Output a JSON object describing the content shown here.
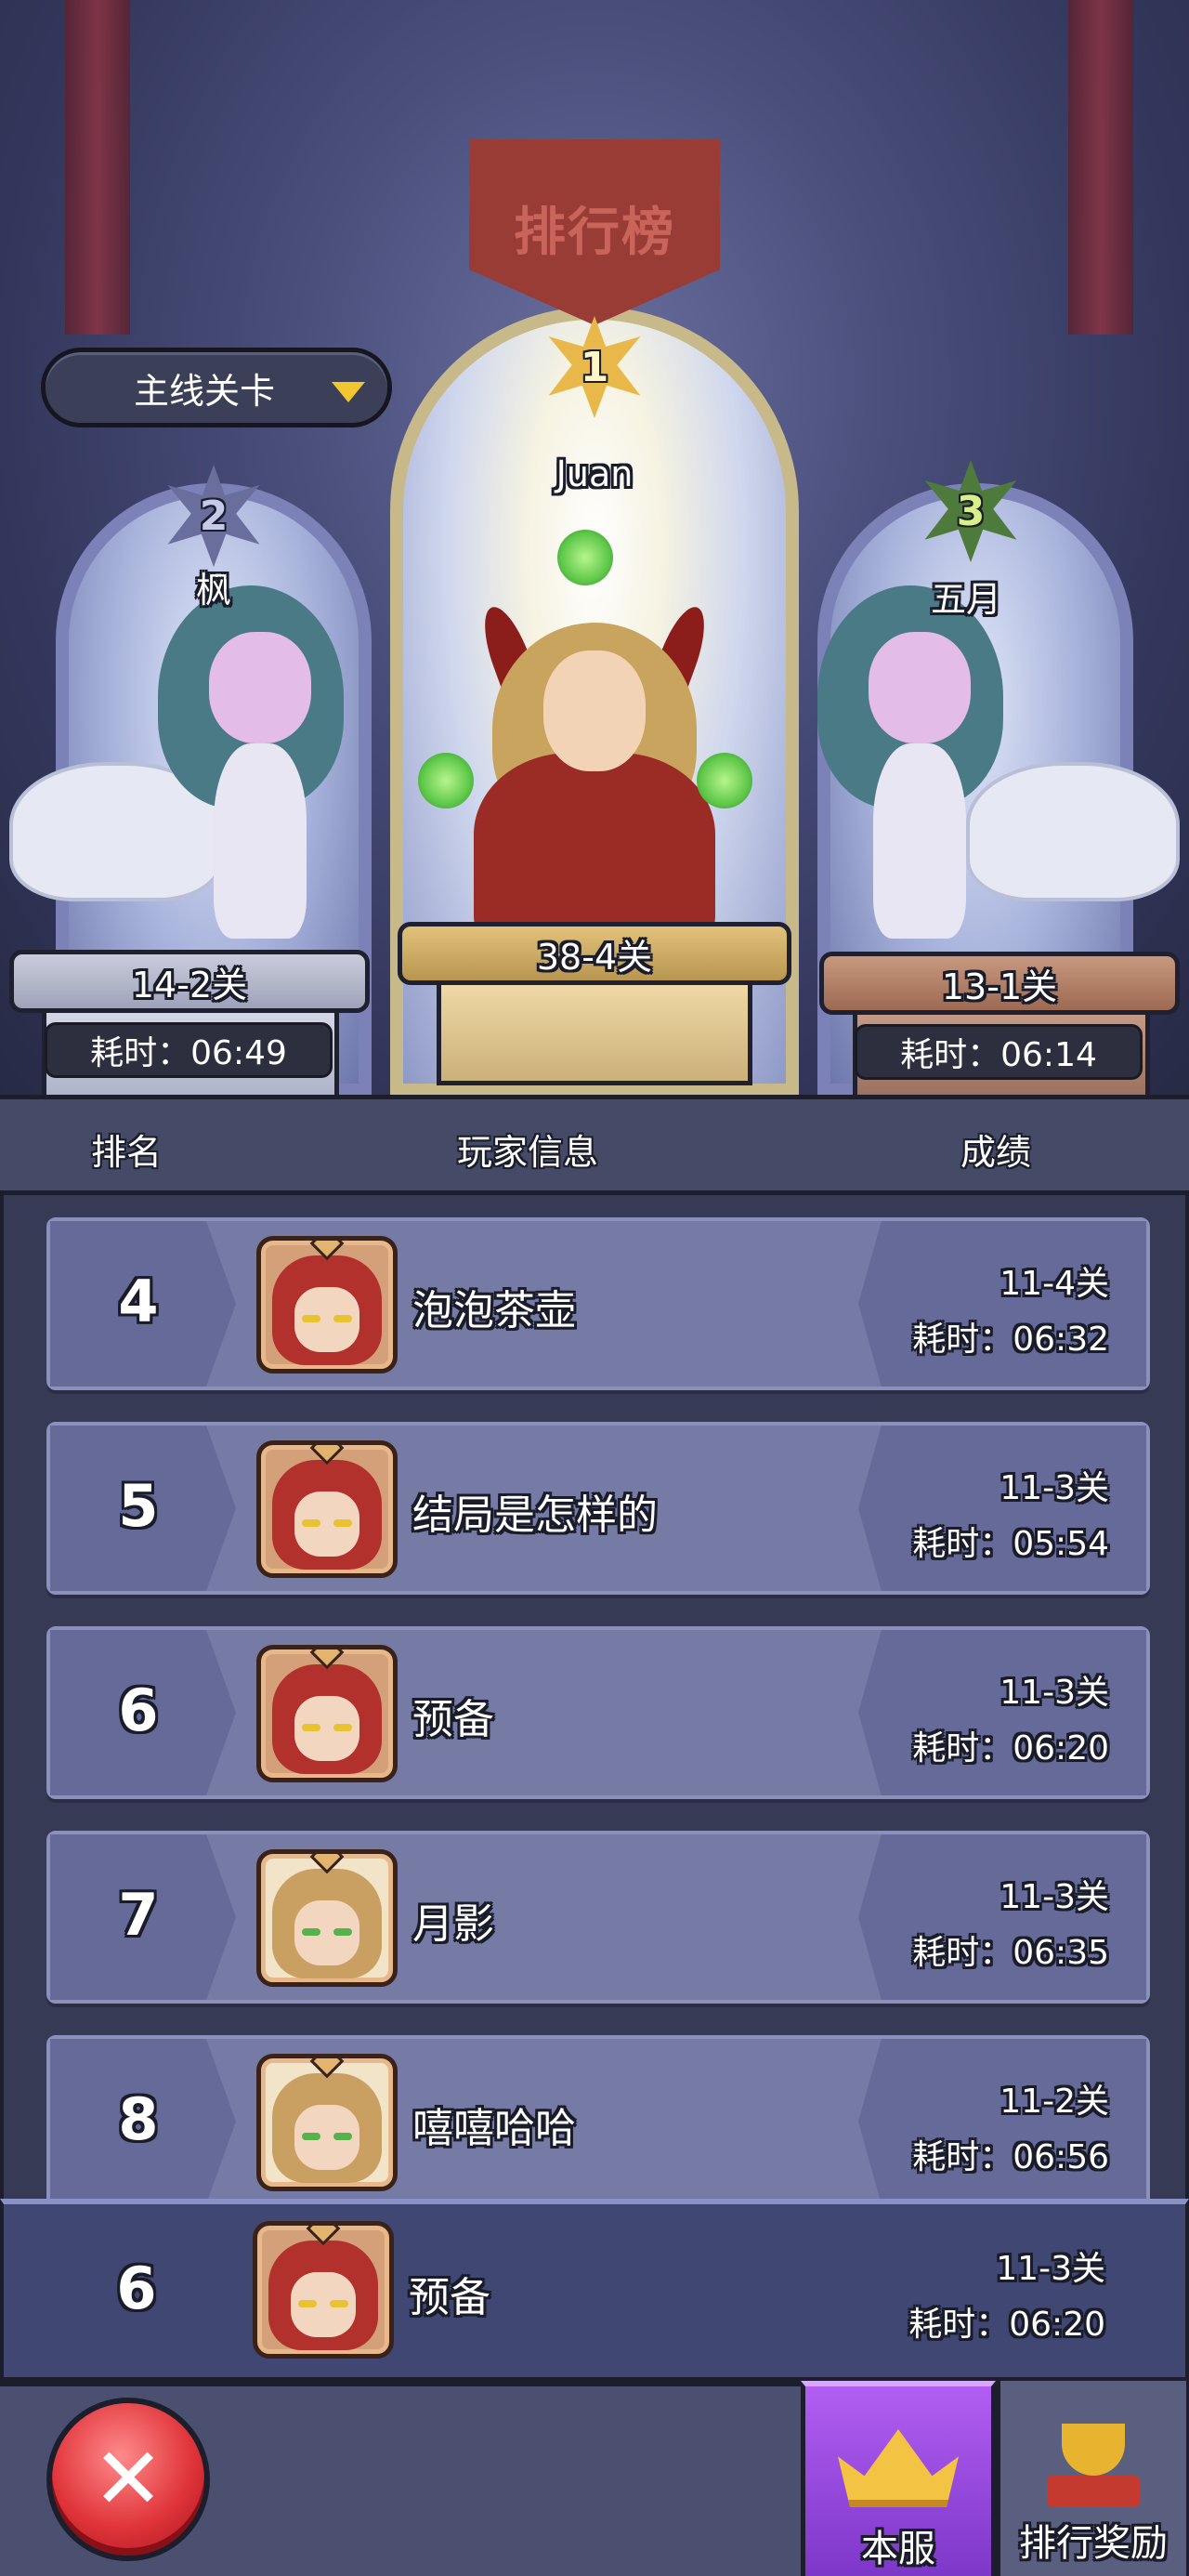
{
  "title": "排行榜",
  "mode_select": {
    "label": "主线关卡"
  },
  "podium": [
    {
      "rank": "1",
      "name": "Juan",
      "stage": "38-4关"
    },
    {
      "rank": "2",
      "name": "枫",
      "stage": "14-2关",
      "time": "耗时：06:49"
    },
    {
      "rank": "3",
      "name": "五月",
      "stage": "13-1关",
      "time": "耗时：06:14"
    }
  ],
  "header": {
    "rank": "排名",
    "player": "玩家信息",
    "score": "成绩"
  },
  "rows": [
    {
      "rank": "4",
      "name": "泡泡茶壶",
      "stage": "11-4关",
      "time": "耗时：06:32",
      "avatar": "red-hair-avatar"
    },
    {
      "rank": "5",
      "name": "结局是怎样的",
      "stage": "11-3关",
      "time": "耗时：05:54",
      "avatar": "red-hair-avatar"
    },
    {
      "rank": "6",
      "name": "预备",
      "stage": "11-3关",
      "time": "耗时：06:20",
      "avatar": "red-hair-avatar"
    },
    {
      "rank": "7",
      "name": "月影",
      "stage": "11-3关",
      "time": "耗时：06:35",
      "avatar": "blond-hair-avatar"
    },
    {
      "rank": "8",
      "name": "嘻嘻哈哈",
      "stage": "11-2关",
      "time": "耗时：06:56",
      "avatar": "blond-hair-avatar"
    }
  ],
  "self_row": {
    "rank": "6",
    "name": "预备",
    "stage": "11-3关",
    "time": "耗时：06:20",
    "avatar": "red-hair-avatar"
  },
  "tabs": [
    {
      "label": "本服",
      "icon": "crown-icon",
      "active": true
    },
    {
      "label": "排行奖励",
      "icon": "trophy-icon",
      "active": false
    }
  ],
  "close_icon": "close-icon",
  "colors": {
    "active_tab": "#9b4be0",
    "close_button": "#e0343a",
    "row_bg": "#767ba6"
  }
}
